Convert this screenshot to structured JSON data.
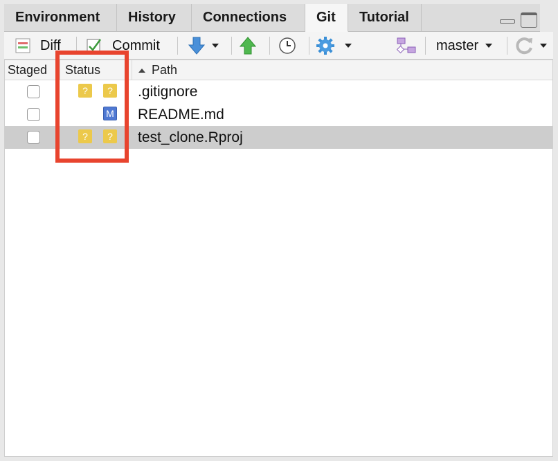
{
  "tabs": [
    {
      "label": "Environment",
      "active": false
    },
    {
      "label": "History",
      "active": false
    },
    {
      "label": "Connections",
      "active": false
    },
    {
      "label": "Git",
      "active": true
    },
    {
      "label": "Tutorial",
      "active": false
    }
  ],
  "toolbar": {
    "diff_label": "Diff",
    "commit_label": "Commit",
    "branch": "master"
  },
  "columns": {
    "staged": "Staged",
    "status": "Status",
    "path": "Path"
  },
  "files": [
    {
      "path": ".gitignore",
      "staged": false,
      "status": [
        "?",
        "?"
      ],
      "selected": false
    },
    {
      "path": "README.md",
      "staged": false,
      "status": [
        "",
        "M"
      ],
      "selected": false
    },
    {
      "path": "test_clone.Rproj",
      "staged": false,
      "status": [
        "?",
        "?"
      ],
      "selected": true
    }
  ],
  "colors": {
    "untracked_badge": "#ecc94b",
    "modified_badge": "#4f79d3",
    "annotation_box": "#e8442e",
    "selected_row": "#cdcdcd"
  }
}
